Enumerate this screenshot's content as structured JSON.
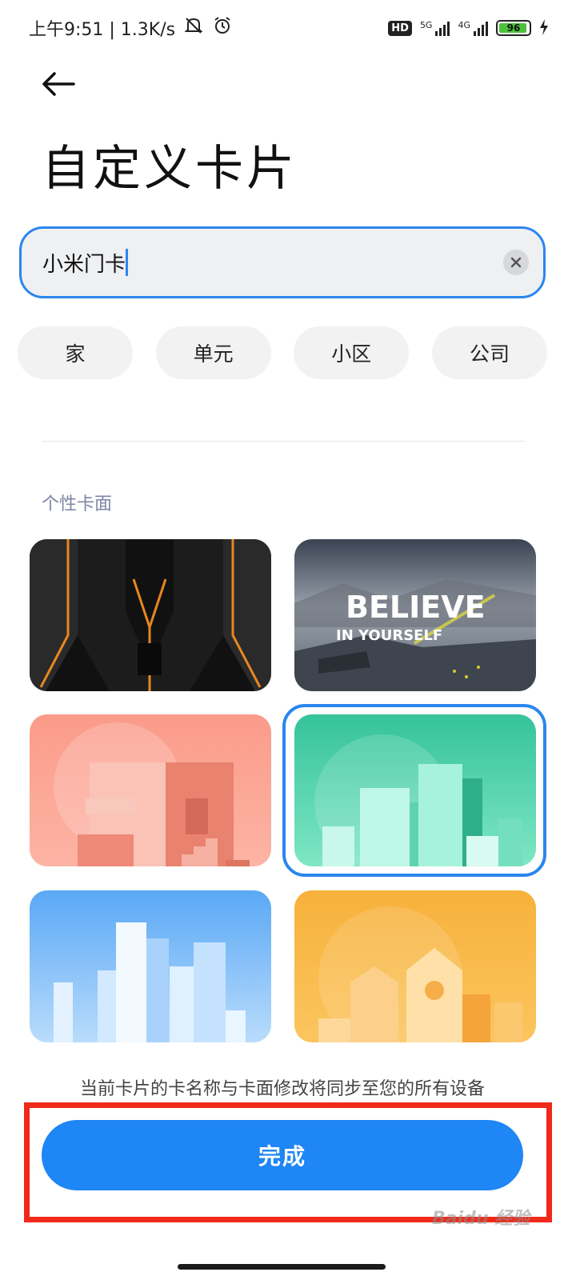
{
  "status_bar": {
    "time_and_speed": "上午9:51 | 1.3K/s",
    "hd_badge": "HD",
    "net_5g": "5G",
    "net_4g": "4G",
    "battery_level": "96",
    "battery_fraction": 0.96
  },
  "header": {
    "title": "自定义卡片"
  },
  "name_input": {
    "value": "小米门卡"
  },
  "quick_names": [
    {
      "label": "家"
    },
    {
      "label": "单元"
    },
    {
      "label": "小区"
    },
    {
      "label": "公司"
    }
  ],
  "card_section": {
    "label": "个性卡面",
    "believe_card_line1": "BELIEVE",
    "believe_card_line2": "IN YOURSELF",
    "selected_index": 3
  },
  "footer": {
    "note": "当前卡片的卡名称与卡面修改将同步至您的所有设备",
    "done_label": "完成"
  },
  "watermark": "Baidu 经验",
  "colors": {
    "accent": "#1e86f5",
    "highlight": "#f02a1a"
  }
}
